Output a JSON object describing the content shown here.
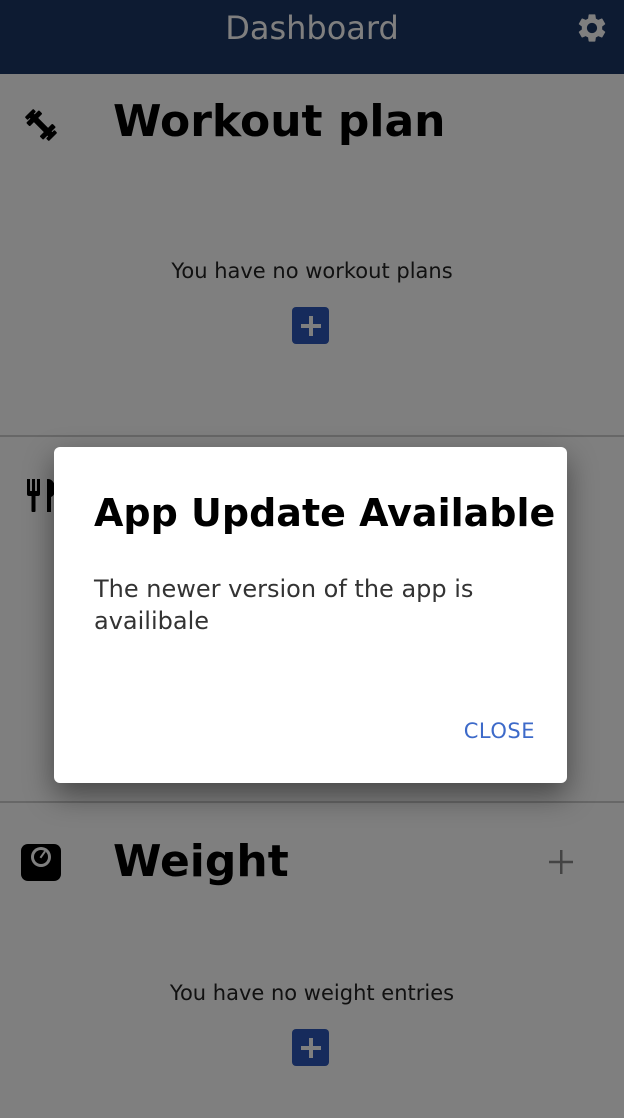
{
  "app_bar": {
    "title": "Dashboard",
    "settings_icon": "gear-icon",
    "background_color": "#1b3665"
  },
  "workout_card": {
    "icon": "dumbbell-icon",
    "title": "Workout plan",
    "empty_message": "You have no workout plans",
    "add_icon": "plus-icon"
  },
  "nutrition_card": {
    "icon": "fork-knife-icon"
  },
  "weight_card": {
    "icon": "scale-icon",
    "title": "Weight",
    "header_add_icon": "plus-icon",
    "empty_message": "You have no weight entries",
    "add_icon": "plus-icon"
  },
  "dialog": {
    "title": "App Update Available",
    "message": "The newer version of the app is availibale",
    "close_label": "CLOSE"
  },
  "colors": {
    "accent": "#2c56b8",
    "dialog_button": "#3d6ac9"
  }
}
